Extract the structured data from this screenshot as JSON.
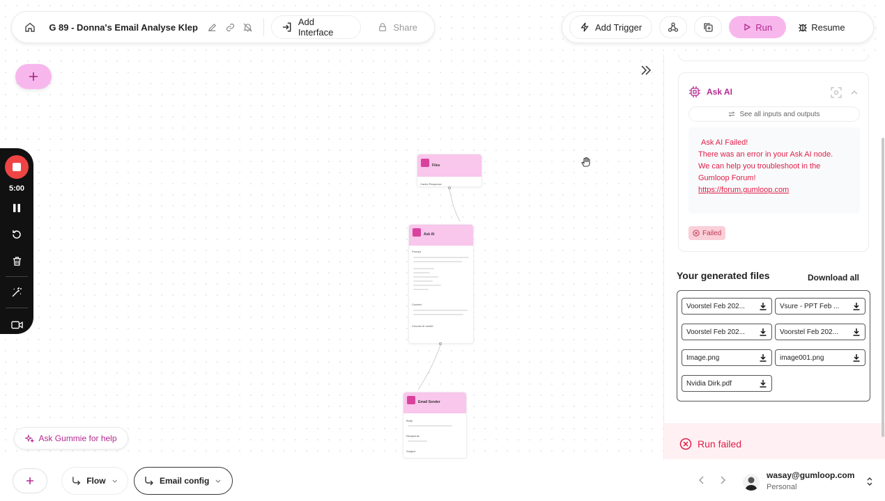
{
  "toolbar": {
    "title": "G 89 - Donna's Email Analyse Klep",
    "add_interface": "Add Interface",
    "share": "Share",
    "add_trigger": "Add Trigger",
    "run": "Run",
    "resume": "Resume"
  },
  "recorder": {
    "time": "5:00"
  },
  "ask_gummie": "Ask Gummie for help",
  "canvas": {
    "node1_title": "Files",
    "node1_field": "Cache Response",
    "node2_title": "Ask AI",
    "node2_prompt": "Prompt",
    "node2_context": "Context",
    "node2_choose_model": "Choose AI model",
    "node3_title": "Email Sender",
    "node3_body": "Body",
    "node3_recipients": "Recipients",
    "node3_subject": "Subject"
  },
  "bottombar": {
    "flow_tab": "Flow",
    "email_tab": "Email config",
    "user_email": "wasay@gumloop.com",
    "user_plan": "Personal"
  },
  "panel": {
    "ai_node_title": "Ask AI",
    "see_all": "See all inputs and outputs",
    "error_lines": [
      "Ask AI Failed!",
      "There was an error in your Ask AI node.",
      "We can help you troubleshoot in the",
      "Gumloop Forum!"
    ],
    "error_link": "https://forum.gumloop.com",
    "failed_badge": "Failed",
    "files_title": "Your generated files",
    "download_all": "Download all",
    "files": [
      "Voorstel Feb 202...",
      "Vsure - PPT Feb ...",
      "Voorstel Feb 202...",
      "Voorstel Feb 202...",
      "Image.png",
      "image001.png",
      "Nvidia Dirk.pdf"
    ],
    "run_failed": "Run failed"
  },
  "colors": {
    "accent_pink": "#f7b7ec",
    "brand_magenta": "#b4288f",
    "error_red": "#e11d48",
    "recorder_stop": "#ef4444"
  }
}
